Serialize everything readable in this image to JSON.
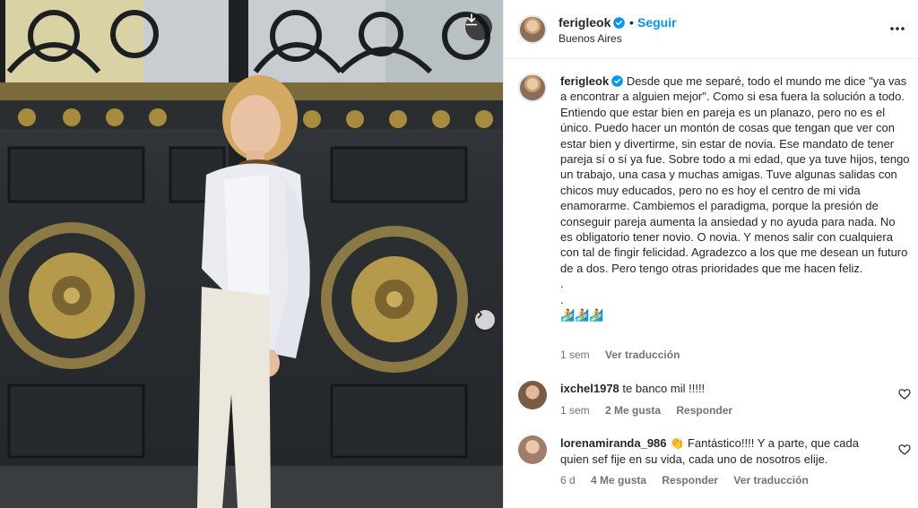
{
  "post": {
    "username": "ferigleok",
    "follow_label": "Seguir",
    "separator": "•",
    "location": "Buenos Aires",
    "caption_username": "ferigleok",
    "caption_text": "Desde que me separé, todo el mundo me dice \"ya vas a encontrar a alguien mejor\". Como si esa fuera la solución a todo. Entiendo que estar bien en pareja es un planazo, pero no es el único. Puedo hacer un montón de cosas que tengan que ver con estar bien y divertirme, sin estar de novia. Ese mandato de tener pareja sí o sí ya fue. Sobre todo a mi edad, que ya tuve hijos, tengo un trabajo, una casa y muchas amigas. Tuve algunas salidas con chicos muy educados, pero no es hoy el centro de mi vida enamorarme. Cambiemos el paradigma, porque la presión de conseguir pareja aumenta la ansiedad y no ayuda para nada. No es obligatorio tener novio. O novia. Y menos salir con cualquiera con tal de fingir felicidad. Agradezco a los que me desean un futuro de a dos. Pero tengo otras prioridades que me hacen feliz.\n.\n.\n🏄🏄🏄",
    "caption_time": "1 sem",
    "translate_label": "Ver traducción"
  },
  "comments": [
    {
      "username": "ixchel1978",
      "text": "te banco mil !!!!!",
      "time": "1 sem",
      "likes": "2 Me gusta",
      "reply_label": "Responder",
      "translate_label": ""
    },
    {
      "username": "lorenamiranda_986",
      "text": "👏 Fantástico!!!! Y a parte, que cada quien sef fije en su vida, cada uno de nosotros elije.",
      "time": "6 d",
      "likes": "4 Me gusta",
      "reply_label": "Responder",
      "translate_label": "Ver traducción"
    }
  ],
  "colors": {
    "accent_blue": "#0095f6",
    "verified_blue": "#0095f6",
    "muted_text": "#737373",
    "border": "#efefef"
  },
  "icons": {
    "download": "download-icon",
    "next": "chevron-right-icon",
    "more": "more-horizontal-icon",
    "verified": "verified-badge-icon",
    "like": "heart-icon"
  }
}
